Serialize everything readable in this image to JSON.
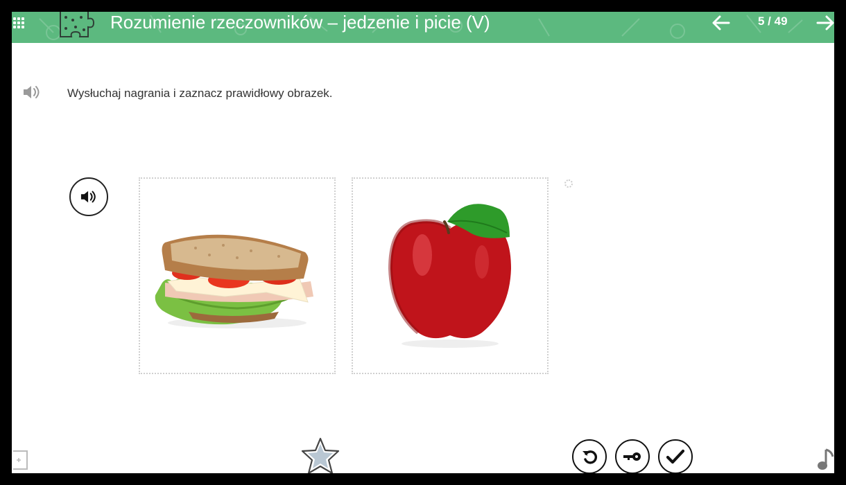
{
  "header": {
    "title": "Rozumienie rzeczowników – jedzenie i picie (V)",
    "counter": "5 / 49",
    "icons": [
      "menu-icon",
      "puzzle-icon",
      "arrow-left-icon",
      "arrow-right-icon"
    ],
    "background_color": "#5cb97f"
  },
  "exercise": {
    "instruction": "Wysłuchaj nagrania i zaznacz prawidłowy obrazek.",
    "options": [
      {
        "name": "sandwich-image"
      },
      {
        "name": "apple-image"
      }
    ]
  },
  "toolbar": {
    "icons": [
      "star-icon",
      "reset-icon",
      "key-icon",
      "check-icon",
      "music-icon"
    ]
  }
}
